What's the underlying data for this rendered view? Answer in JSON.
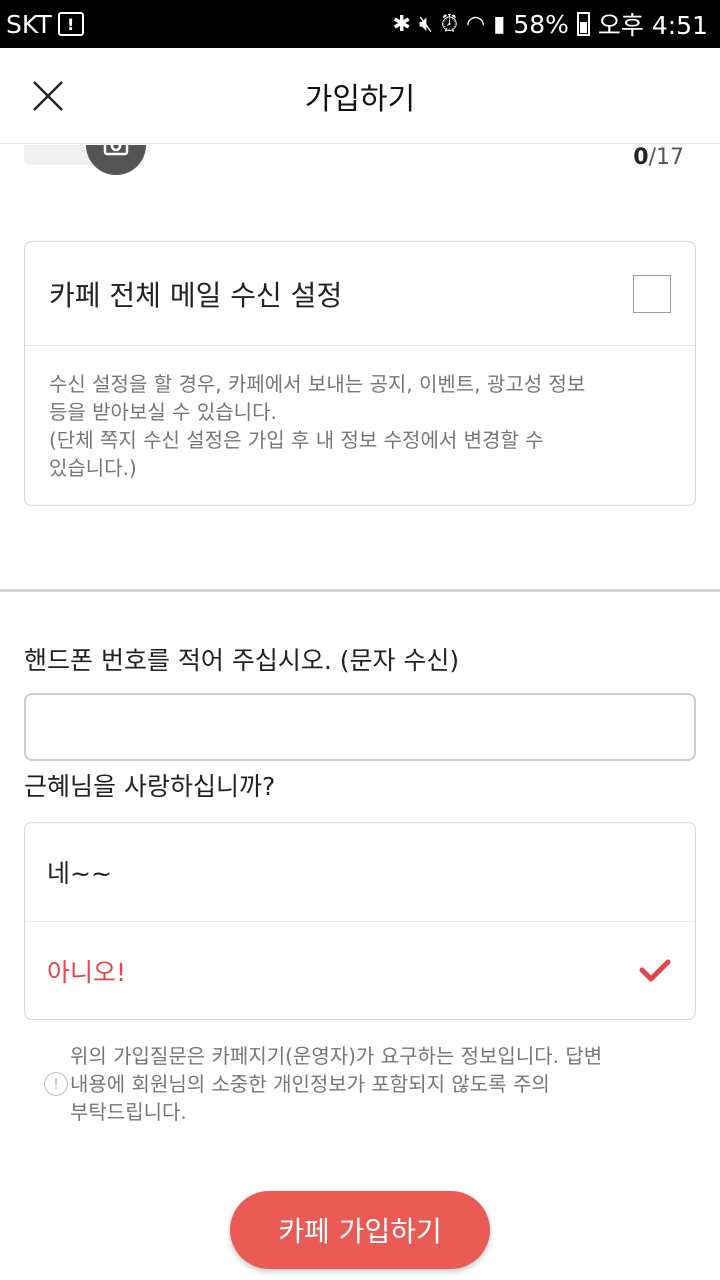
{
  "status_bar": {
    "carrier": "SKT",
    "battery": "58%",
    "time": "오후 4:51"
  },
  "header": {
    "title": "가입하기"
  },
  "nickname": {
    "count_current": "0",
    "count_max": "/17"
  },
  "mail_setting": {
    "title": "카페 전체 메일 수신 설정",
    "desc_line1": "수신 설정을 할 경우, 카페에서 보내는 공지, 이벤트, 광고성 정보",
    "desc_line2": "등을 받아보실 수 있습니다.",
    "desc_line3": "(단체 쪽지 수신 설정은 가입 후 내 정보 수정에서 변경할 수",
    "desc_line4": "있습니다.)",
    "checked": false
  },
  "question1": {
    "label": "핸드폰 번호를 적어 주십시오. (문자 수신)",
    "value": ""
  },
  "question2": {
    "label": "근혜님을 사랑하십니까?",
    "options": [
      "네~~",
      "아니오!"
    ],
    "selected": "아니오!"
  },
  "notice": {
    "line1": "위의 가입질문은 카페지기(운영자)가 요구하는 정보입니다. 답변",
    "line2": "내용에 회원님의 소중한 개인정보가 포함되지 않도록 주의",
    "line3": "부탁드립니다."
  },
  "submit": {
    "label": "카페 가입하기"
  },
  "colors": {
    "accent": "#e0474b",
    "button": "#ea5b55"
  }
}
